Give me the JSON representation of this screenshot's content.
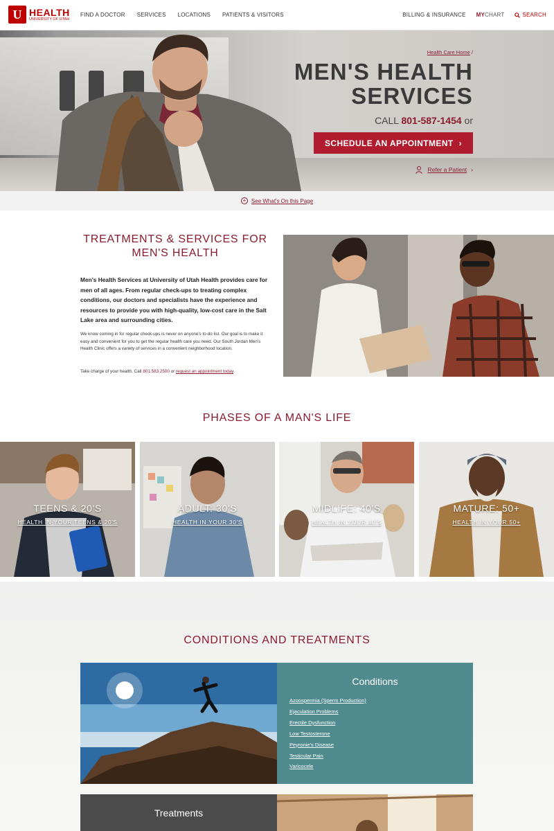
{
  "header": {
    "logo_mark": "U",
    "logo_name": "HEALTH",
    "logo_sub": "UNIVERSITY OF UTAH",
    "nav_left": [
      "FIND A DOCTOR",
      "SERVICES",
      "LOCATIONS",
      "PATIENTS & VISITORS"
    ],
    "billing": "BILLING & INSURANCE",
    "mychart_my": "MY",
    "mychart_chart": "CHART",
    "search": "SEARCH"
  },
  "hero": {
    "breadcrumb": "Health Care Home",
    "breadcrumb_sep": "/",
    "title_line1": "MEN'S HEALTH",
    "title_line2": "SERVICES",
    "call_prefix": "CALL",
    "phone": "801-587-1454",
    "call_suffix": "or",
    "cta": "SCHEDULE AN APPOINTMENT",
    "refer": "Refer a Patient"
  },
  "jumpbar": {
    "label": "See What's On this Page"
  },
  "intro": {
    "title": "TREATMENTS & SERVICES FOR MEN'S HEALTH",
    "lead": "Men's Health Services at University of Utah Health provides care for men of all ages. From regular check-ups to treating complex conditions, our doctors and specialists have the experience and resources to provide you with high-quality, low-cost care in the Salt Lake area and surrounding cities.",
    "body": "We know coming in for regular check-ups is never on anyone's to-do list. Our goal is to make it easy and convenient for you to get the regular health care you need. Our South Jordan Men's Health Clinic offers a variety of services in a convenient neighborhood location.",
    "cta_prefix": "Take charge of your health. Call",
    "cta_phone": "801.583.2500",
    "cta_or": "or",
    "cta_link": "request an appointment today",
    "cta_end": "."
  },
  "phases": {
    "title": "PHASES OF A MAN'S LIFE",
    "cards": [
      {
        "label": "TEENS & 20'S",
        "link": "HEALTH IN YOUR TEENS & 20'S"
      },
      {
        "label": "ADULT: 30'S",
        "link": "HEALTH IN YOUR 30'S"
      },
      {
        "label": "MIDLIFE: 40'S",
        "link": "HEALTH IN YOUR 40'S"
      },
      {
        "label": "MATURE: 50+",
        "link": "HEALTH IN YOUR 50+"
      }
    ]
  },
  "conditions": {
    "title": "CONDITIONS AND TREATMENTS",
    "panel_title": "Conditions",
    "items": [
      "Azoospermia (Sperm Production)",
      "Ejaculation Problems",
      "Erectile Dysfunction",
      "Low Testosterone",
      "Peyronie's Disease",
      "Testicular Pain",
      "Varicocele"
    ],
    "treatments_title": "Treatments"
  },
  "colors": {
    "brand_red": "#be0000",
    "crimson": "#8a1b2e",
    "cta_red": "#b01c2e",
    "teal": "#4f8a8f"
  }
}
